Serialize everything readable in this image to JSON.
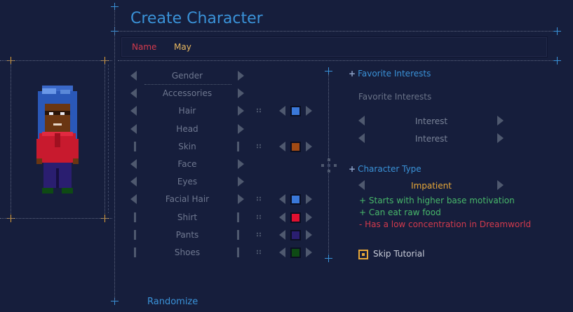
{
  "title": "Create Character",
  "name_field": {
    "label": "Name",
    "value": "May"
  },
  "options": [
    {
      "label": "Gender",
      "kind": "arrows"
    },
    {
      "label": "Accessories",
      "kind": "arrows"
    },
    {
      "label": "Hair",
      "kind": "arrows",
      "color": "#3a78d8"
    },
    {
      "label": "Head",
      "kind": "arrows"
    },
    {
      "label": "Skin",
      "kind": "bars",
      "color": "#a04a14"
    },
    {
      "label": "Face",
      "kind": "arrows"
    },
    {
      "label": "Eyes",
      "kind": "arrows"
    },
    {
      "label": "Facial Hair",
      "kind": "arrows",
      "color": "#3a78d8"
    },
    {
      "label": "Shirt",
      "kind": "bars",
      "color": "#e01030"
    },
    {
      "label": "Pants",
      "kind": "bars",
      "color": "#2a1e70"
    },
    {
      "label": "Shoes",
      "kind": "bars",
      "color": "#0e4a14"
    }
  ],
  "interests": {
    "header": "Favorite Interests",
    "subheader": "Favorite Interests",
    "items": [
      "Interest",
      "Interest"
    ]
  },
  "character_type": {
    "header": "Character Type",
    "value": "Impatient",
    "traits": [
      {
        "text": "+ Starts with higher base motivation",
        "tone": "positive"
      },
      {
        "text": "+ Can eat raw food",
        "tone": "positive"
      },
      {
        "text": "- Has a low concentration in Dreamworld",
        "tone": "negative"
      }
    ]
  },
  "skip_tutorial": {
    "label": "Skip Tutorial",
    "checked": true
  },
  "randomize": "Randomize",
  "colors": {
    "accent": "#3a92d8",
    "positive": "#48b86a",
    "negative": "#d23a4d",
    "highlight": "#e8a838"
  }
}
